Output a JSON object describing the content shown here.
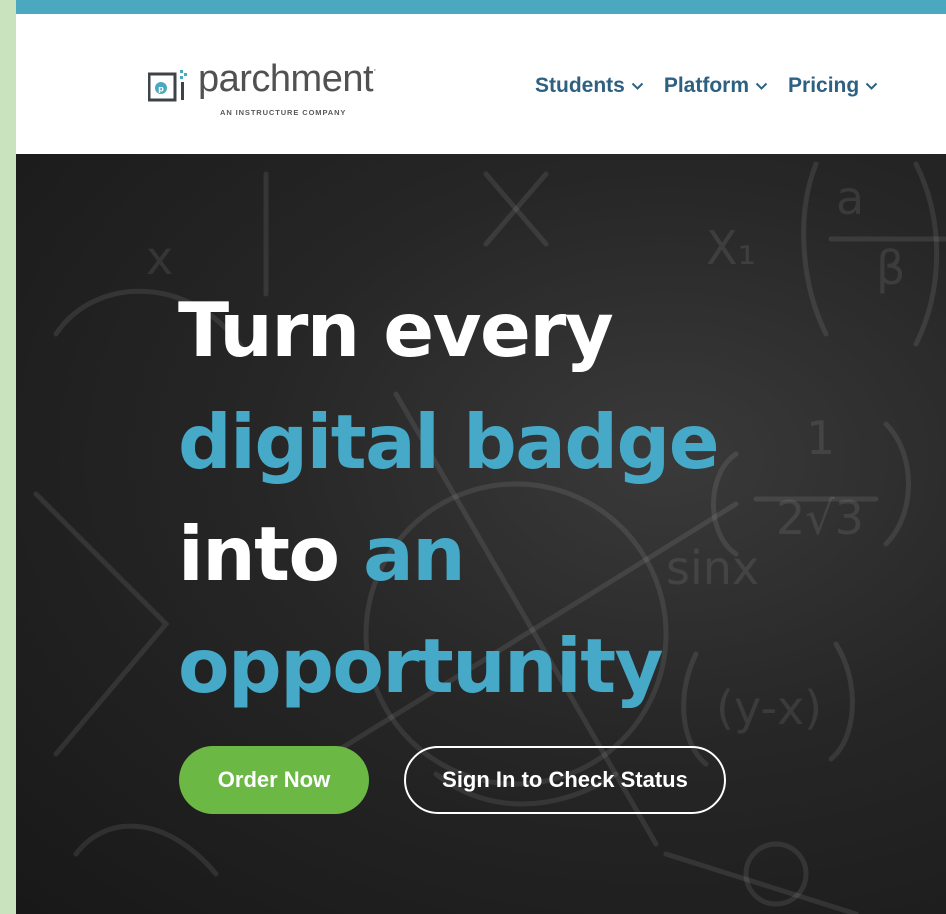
{
  "brand": {
    "name": "parchment",
    "tagline": "AN INSTRUCTURE COMPANY",
    "colors": {
      "stripe": "#4aa8bf",
      "nav": "#2e6081",
      "accent": "#45a9c7",
      "cta": "#6bb845"
    }
  },
  "nav": {
    "items": [
      {
        "label": "Students",
        "icon": "chevron-down-icon"
      },
      {
        "label": "Platform",
        "icon": "chevron-down-icon"
      },
      {
        "label": "Pricing",
        "icon": "chevron-down-icon"
      }
    ]
  },
  "hero": {
    "headline": {
      "line1": "Turn every",
      "line2": "digital badge",
      "line3_white": "into ",
      "line3_blue": "an",
      "line4": "opportunity"
    },
    "primary_button": "Order Now",
    "secondary_button": "Sign In to Check Status",
    "background": "chalkboard-math-image"
  }
}
